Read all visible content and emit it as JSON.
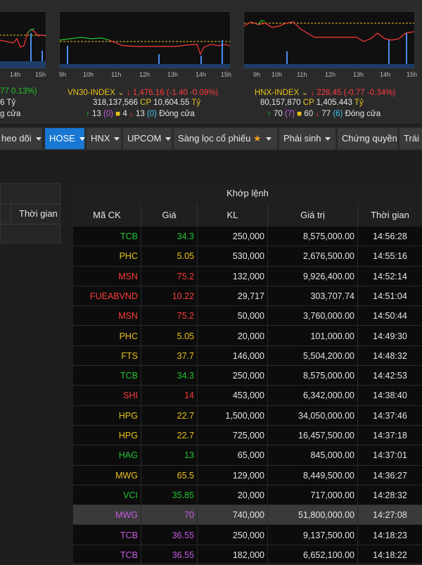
{
  "charts": {
    "left": {
      "xlabels": [
        "14h",
        "15h"
      ]
    },
    "mid": {
      "xlabels": [
        "9h",
        "10h",
        "11h",
        "12h",
        "13h",
        "14h",
        "15h"
      ]
    },
    "right": {
      "xlabels": [
        "9h",
        "10h",
        "11h",
        "12h",
        "13h",
        "14h",
        "15h"
      ]
    }
  },
  "indices": {
    "left": {
      "change": "77 0.13%)",
      "value_tail": "6 Tỷ",
      "status_tail": "g cửa"
    },
    "vn30": {
      "name": "VN30-INDEX",
      "value": "1,476.16",
      "change": "(-1.40 -0.09%)",
      "volume": "318,137,566",
      "cp_label": "CP",
      "value_bn": "10,604.55",
      "unit": "Tỷ",
      "up": "13",
      "ceil": "(0)",
      "ref": "4",
      "down": "13",
      "floor": "(0)",
      "status": "Đóng cửa"
    },
    "hnx": {
      "name": "HNX-INDEX",
      "value": "228.45",
      "change": "(-0.77 -0.34%)",
      "volume": "80,157,870",
      "cp_label": "CP",
      "value_bn": "1,405.443",
      "unit": "Tỷ",
      "up": "70",
      "ceil": "(7)",
      "ref": "60",
      "down": "77",
      "floor": "(6)",
      "status": "Đóng cửa"
    }
  },
  "tabs": [
    "heo dõi",
    "HOSE",
    "HNX",
    "UPCOM",
    "Sàng lọc cổ phiếu",
    "Phái sinh",
    "Chứng quyền",
    "Trái p"
  ],
  "left_panel": {
    "time_header": "Thời gian"
  },
  "order_panel": {
    "title": "Khớp lệnh",
    "headers": [
      "Mã CK",
      "Giá",
      "KL",
      "Giá trị",
      "Thời gian"
    ],
    "rows": [
      {
        "sym": "TCB",
        "price": "34.3",
        "vol": "250,000",
        "val": "8,575,000.00",
        "time": "14:56:28",
        "color": "up"
      },
      {
        "sym": "PHC",
        "price": "5.05",
        "vol": "530,000",
        "val": "2,676,500.00",
        "time": "14:55:16",
        "color": "ref"
      },
      {
        "sym": "MSN",
        "price": "75.2",
        "vol": "132,000",
        "val": "9,926,400.00",
        "time": "14:52:14",
        "color": "down"
      },
      {
        "sym": "FUEABVND",
        "price": "10.22",
        "vol": "29,717",
        "val": "303,707.74",
        "time": "14:51:04",
        "color": "down"
      },
      {
        "sym": "MSN",
        "price": "75.2",
        "vol": "50,000",
        "val": "3,760,000.00",
        "time": "14:50:44",
        "color": "down"
      },
      {
        "sym": "PHC",
        "price": "5.05",
        "vol": "20,000",
        "val": "101,000.00",
        "time": "14:49:30",
        "color": "ref"
      },
      {
        "sym": "FTS",
        "price": "37.7",
        "vol": "146,000",
        "val": "5,504,200.00",
        "time": "14:48:32",
        "color": "ref"
      },
      {
        "sym": "TCB",
        "price": "34.3",
        "vol": "250,000",
        "val": "8,575,000.00",
        "time": "14:42:53",
        "color": "up"
      },
      {
        "sym": "SHI",
        "price": "14",
        "vol": "453,000",
        "val": "6,342,000.00",
        "time": "14:38:40",
        "color": "down"
      },
      {
        "sym": "HPG",
        "price": "22.7",
        "vol": "1,500,000",
        "val": "34,050,000.00",
        "time": "14:37:46",
        "color": "ref"
      },
      {
        "sym": "HPG",
        "price": "22.7",
        "vol": "725,000",
        "val": "16,457,500.00",
        "time": "14:37:18",
        "color": "ref"
      },
      {
        "sym": "HAG",
        "price": "13",
        "vol": "65,000",
        "val": "845,000.00",
        "time": "14:37:01",
        "color": "up"
      },
      {
        "sym": "MWG",
        "price": "65.5",
        "vol": "129,000",
        "val": "8,449,500.00",
        "time": "14:36:27",
        "color": "ref"
      },
      {
        "sym": "VCI",
        "price": "35.85",
        "vol": "20,000",
        "val": "717,000.00",
        "time": "14:28:32",
        "color": "up"
      },
      {
        "sym": "MWG",
        "price": "70",
        "vol": "740,000",
        "val": "51,800,000.00",
        "time": "14:27:08",
        "color": "ceil",
        "highlight": true
      },
      {
        "sym": "TCB",
        "price": "36.55",
        "vol": "250,000",
        "val": "9,137,500.00",
        "time": "14:18:23",
        "color": "ceil"
      },
      {
        "sym": "TCB",
        "price": "36.55",
        "vol": "182,000",
        "val": "6,652,100.00",
        "time": "14:18:22",
        "color": "ceil"
      }
    ]
  }
}
